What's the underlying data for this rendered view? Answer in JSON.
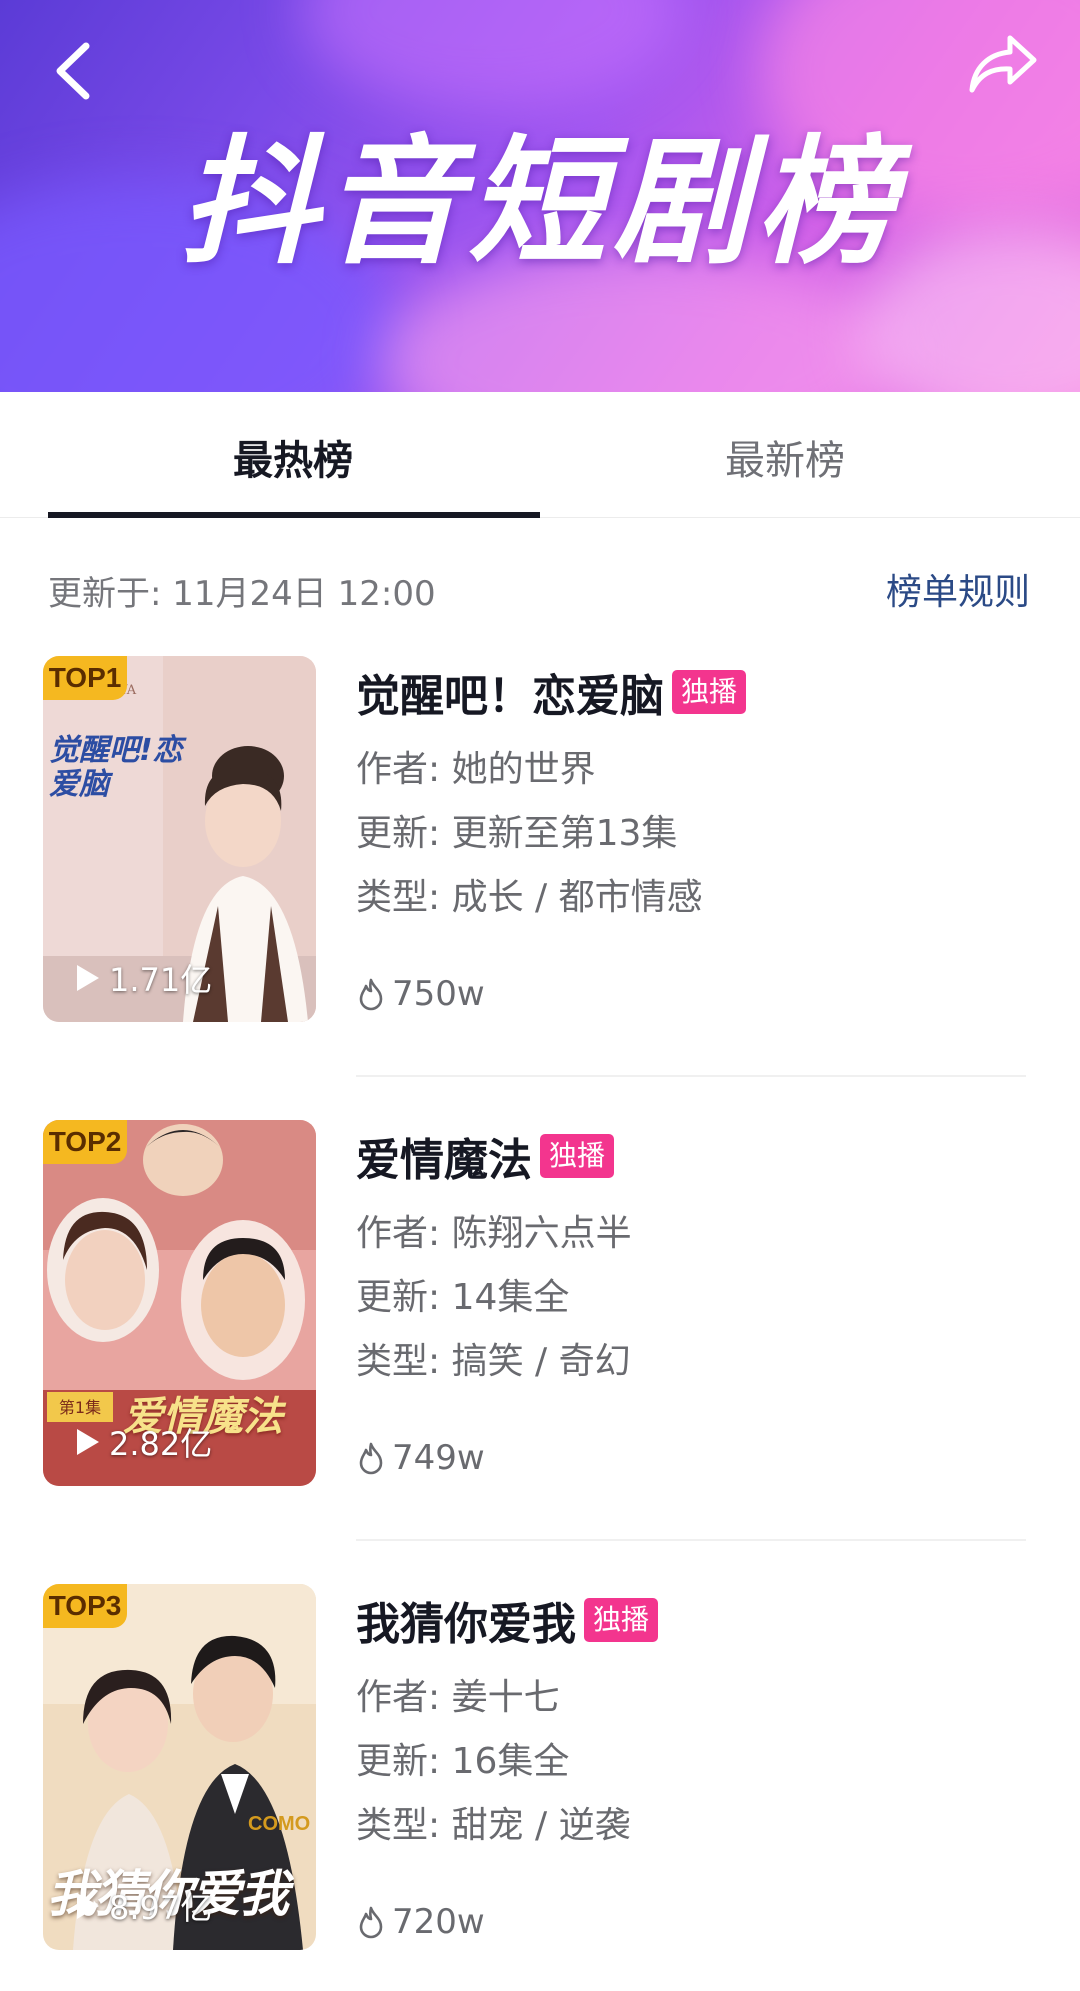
{
  "header": {
    "title": "抖音短剧榜",
    "back_icon": "back-arrow-icon",
    "share_icon": "share-icon"
  },
  "tabs": [
    {
      "label": "最热榜",
      "active": true
    },
    {
      "label": "最新榜",
      "active": false
    }
  ],
  "info": {
    "update_time": "更新于: 11月24日 12:00",
    "rules_label": "榜单规则"
  },
  "labels": {
    "author": "作者:",
    "update": "更新:",
    "genre": "类型:",
    "exclusive": "独播"
  },
  "items": [
    {
      "rank": "TOP1",
      "title": "觉醒吧！恋爱脑",
      "author": "她的世界",
      "update": "更新至第13集",
      "genre": "成长 / 都市情感",
      "plays": "1.71亿",
      "heat": "750w",
      "poster_text": "觉醒吧!恋爱脑",
      "poster_brand": "PROYA"
    },
    {
      "rank": "TOP2",
      "title": "爱情魔法",
      "author": "陈翔六点半",
      "update": "14集全",
      "genre": "搞笑 / 奇幻",
      "plays": "2.82亿",
      "heat": "749w",
      "poster_text": "爱情魔法",
      "poster_brand": "第1集"
    },
    {
      "rank": "TOP3",
      "title": "我猜你爱我",
      "author": "姜十七",
      "update": "16集全",
      "genre": "甜宠 / 逆袭",
      "plays": "8.97亿",
      "heat": "720w",
      "poster_text": "我猜你爱我",
      "poster_brand": "COMO"
    }
  ],
  "colors": {
    "exclusive_badge": "#f3358e",
    "rank_badge": "#f5b820",
    "rules_link": "#2b4a86",
    "active_tab": "#161823"
  }
}
